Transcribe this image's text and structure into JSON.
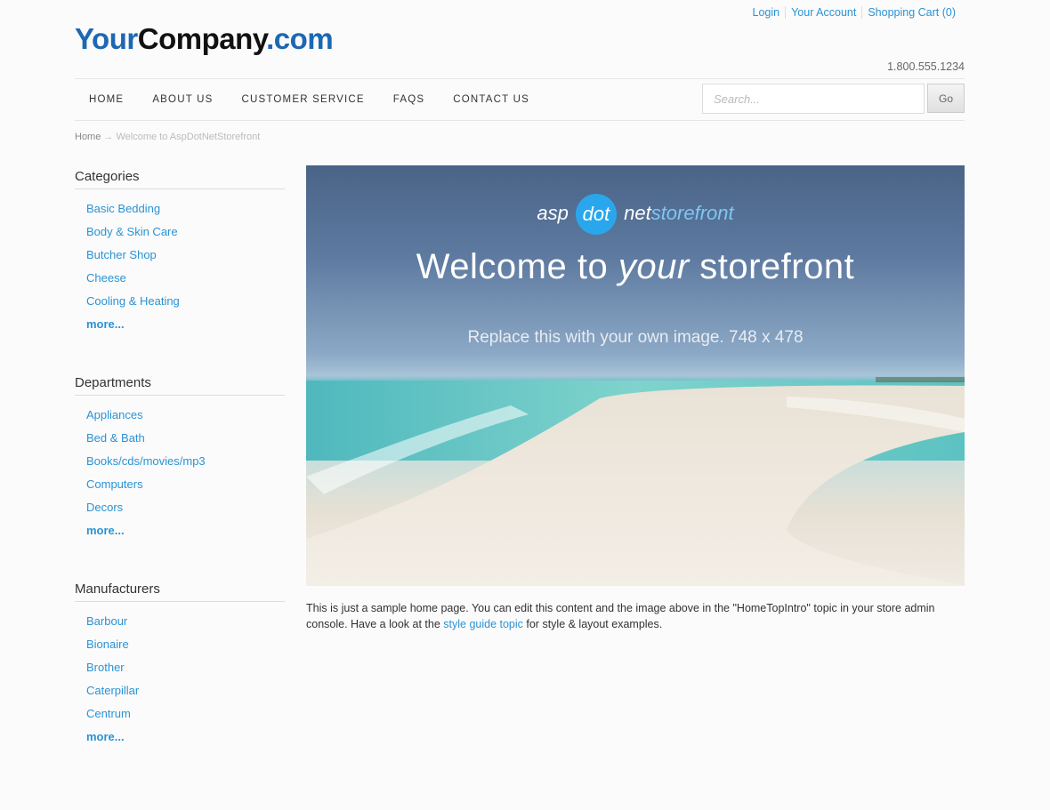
{
  "header": {
    "logo": {
      "part1": "Your",
      "part2": "Company",
      "part3": ".com"
    },
    "top_links": [
      "Login",
      "Your Account",
      "Shopping Cart (0)"
    ],
    "phone": "1.800.555.1234"
  },
  "nav": {
    "items": [
      "HOME",
      "ABOUT US",
      "CUSTOMER SERVICE",
      "FAQS",
      "CONTACT US"
    ],
    "search_placeholder": "Search...",
    "go_label": "Go"
  },
  "breadcrumb": {
    "home": "Home",
    "separator": "→",
    "current": "Welcome to AspDotNetStorefront"
  },
  "sidebar": {
    "groups": [
      {
        "title": "Categories",
        "items": [
          "Basic Bedding",
          "Body & Skin Care",
          "Butcher Shop",
          "Cheese",
          "Cooling & Heating"
        ],
        "more": "more..."
      },
      {
        "title": "Departments",
        "items": [
          "Appliances",
          "Bed & Bath",
          "Books/cds/movies/mp3",
          "Computers",
          "Decors"
        ],
        "more": "more..."
      },
      {
        "title": "Manufacturers",
        "items": [
          "Barbour",
          "Bionaire",
          "Brother",
          "Caterpillar",
          "Centrum"
        ],
        "more": "more..."
      }
    ]
  },
  "hero": {
    "brand_asp": "asp",
    "brand_dot": "dot",
    "brand_net": "net",
    "brand_sf": "storefront",
    "title_pre": "Welcome to ",
    "title_em": "your",
    "title_post": " storefront",
    "subtitle": "Replace this with your own image. 748 x 478"
  },
  "intro": {
    "text1": "This is just a sample home page. You can edit this content and the image above in the \"HomeTopIntro\" topic in your store admin console. Have a look at the ",
    "link": "style guide topic",
    "text2": " for style & layout examples."
  },
  "colors": {
    "link": "#2a93d5",
    "logo_blue": "#1d68b3"
  }
}
